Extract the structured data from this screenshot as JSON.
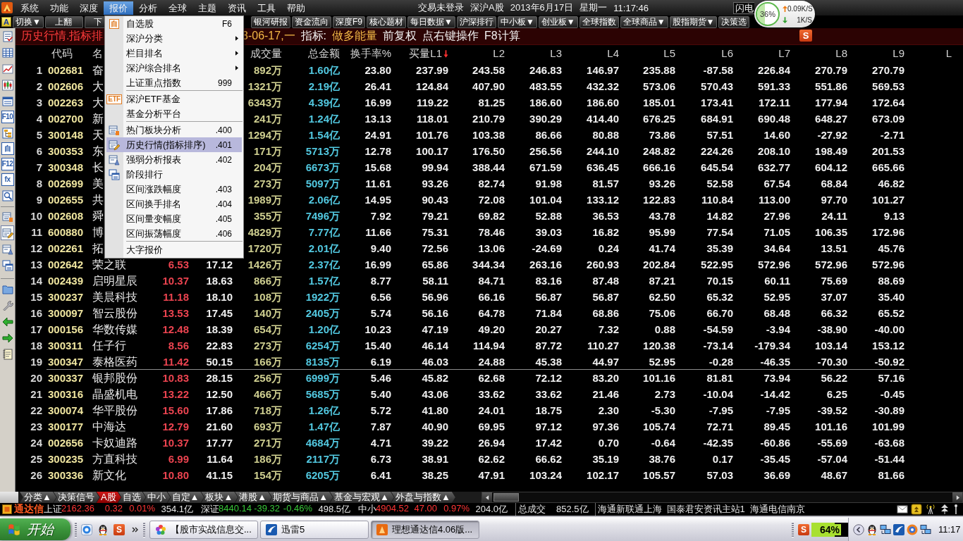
{
  "menubar": {
    "items": [
      {
        "label": "系统",
        "selected": false
      },
      {
        "label": "功能",
        "selected": false
      },
      {
        "label": "深度",
        "selected": false
      },
      {
        "label": "报价",
        "selected": true
      },
      {
        "label": "分析",
        "selected": false
      },
      {
        "label": "全球",
        "selected": false
      },
      {
        "label": "主题",
        "selected": false
      },
      {
        "label": "资讯",
        "selected": false
      },
      {
        "label": "工具",
        "selected": false
      },
      {
        "label": "帮助",
        "selected": false
      }
    ],
    "login_status": "交易未登录",
    "market": "深沪A股",
    "date": "2013年6月17日",
    "weekday": "星期一",
    "time": "11:17:46",
    "flash_box": "闪电"
  },
  "speed_widget": {
    "level": 0.36,
    "reading": "36%",
    "upload": "0.09K/S",
    "download": "1K/S"
  },
  "ime_toolbar": {
    "badge": "S"
  },
  "toolbar": {
    "tile": "A",
    "left": [
      "切换▼",
      "上翻",
      "下"
    ],
    "right": [
      "银河研报",
      "资金流向",
      "深度F9",
      "核心题材",
      "每日数据▼",
      "沪深排行",
      "中小板▼",
      "创业板▼",
      "全球指数",
      "全球商品▼",
      "股指期货▼",
      "决策选"
    ]
  },
  "sidebar": {
    "groups": [
      {
        "tools": [
          {
            "kind": "report",
            "selected": false
          },
          {
            "kind": "grid",
            "selected": false
          },
          {
            "kind": "line",
            "selected": false
          },
          {
            "kind": "candle",
            "selected": false
          },
          {
            "kind": "window",
            "selected": false
          },
          {
            "kind": "glyph",
            "glyph": "F10",
            "selected": false
          },
          {
            "kind": "tree",
            "selected": false
          },
          {
            "kind": "glyph",
            "glyph": "自",
            "selected": false
          },
          {
            "kind": "glyph",
            "glyph": "F12",
            "selected": false
          },
          {
            "kind": "glyph",
            "glyph": "fx",
            "selected": false
          },
          {
            "kind": "search",
            "selected": false
          }
        ]
      },
      {
        "tools": [
          {
            "kind": "hot",
            "selected": false
          },
          {
            "kind": "pencil",
            "selected": true
          },
          {
            "kind": "sheet",
            "selected": false
          },
          {
            "kind": "stack",
            "selected": false
          }
        ]
      },
      {
        "tools": [
          {
            "kind": "folder",
            "selected": false
          },
          {
            "kind": "wrench",
            "selected": false
          },
          {
            "kind": "back",
            "selected": false
          },
          {
            "kind": "forward",
            "selected": false
          },
          {
            "kind": "notebook",
            "selected": false
          }
        ]
      }
    ]
  },
  "title_bar": {
    "title": "历史行情.指标排",
    "info": [
      {
        "text": "3-06-17,一",
        "kind": "highlight"
      },
      {
        "text": "指标:",
        "kind": "plain"
      },
      {
        "text": "做多能量",
        "kind": "highlight"
      },
      {
        "text": "前复权",
        "kind": "plain"
      },
      {
        "text": "点右键操作",
        "kind": "plain"
      },
      {
        "text": "F8计算",
        "kind": "plain"
      }
    ]
  },
  "table": {
    "header": {
      "code": "代码",
      "name": "名",
      "volume": "成交量",
      "amount": "总金额",
      "turnover": "换手率%",
      "l_columns": [
        {
          "label": "买量L1",
          "sorted": true
        },
        {
          "label": "L2",
          "sorted": false
        },
        {
          "label": "L3",
          "sorted": false
        },
        {
          "label": "L4",
          "sorted": false
        },
        {
          "label": "L5",
          "sorted": false
        },
        {
          "label": "L6",
          "sorted": false
        },
        {
          "label": "L7",
          "sorted": false
        },
        {
          "label": "L8",
          "sorted": false
        },
        {
          "label": "L9",
          "sorted": false
        },
        {
          "label": "L",
          "sorted": false
        }
      ]
    },
    "rows": [
      {
        "no": "1",
        "code": "002681",
        "name": "奋",
        "volume": "892万",
        "amount": "1.60亿",
        "turnover": "23.80",
        "l_values": [
          "237.99",
          "243.58",
          "246.83",
          "146.97",
          "235.88",
          "-87.58",
          "226.84",
          "270.79",
          "270.79"
        ],
        "rule_below": false
      },
      {
        "no": "2",
        "code": "002606",
        "name": "大",
        "volume": "1321万",
        "amount": "2.19亿",
        "turnover": "26.41",
        "l_values": [
          "124.84",
          "407.90",
          "483.55",
          "432.32",
          "573.06",
          "570.43",
          "591.33",
          "551.86",
          "569.53"
        ],
        "rule_below": false
      },
      {
        "no": "3",
        "code": "002263",
        "name": "大",
        "volume": "6343万",
        "amount": "4.39亿",
        "turnover": "16.99",
        "l_values": [
          "119.22",
          "81.25",
          "186.60",
          "186.60",
          "185.01",
          "173.41",
          "172.11",
          "177.94",
          "172.64"
        ],
        "rule_below": false
      },
      {
        "no": "4",
        "code": "002700",
        "name": "新",
        "volume": "241万",
        "amount": "1.24亿",
        "turnover": "13.13",
        "l_values": [
          "118.01",
          "210.79",
          "390.29",
          "414.40",
          "676.25",
          "684.91",
          "690.48",
          "648.27",
          "673.09"
        ],
        "rule_below": false
      },
      {
        "no": "5",
        "code": "300148",
        "name": "天",
        "volume": "1294万",
        "amount": "1.54亿",
        "turnover": "24.91",
        "l_values": [
          "101.76",
          "103.38",
          "86.66",
          "80.88",
          "73.86",
          "57.51",
          "14.60",
          "-27.92",
          "-2.71"
        ],
        "rule_below": false
      },
      {
        "no": "6",
        "code": "300353",
        "name": "东",
        "volume": "171万",
        "amount": "5713万",
        "turnover": "12.78",
        "l_values": [
          "100.17",
          "176.50",
          "256.56",
          "244.10",
          "248.82",
          "224.26",
          "208.10",
          "198.49",
          "201.53"
        ],
        "rule_below": false
      },
      {
        "no": "7",
        "code": "300348",
        "name": "长",
        "volume": "204万",
        "amount": "6673万",
        "turnover": "15.68",
        "l_values": [
          "99.94",
          "388.44",
          "671.59",
          "636.45",
          "666.16",
          "645.54",
          "632.77",
          "604.12",
          "665.66"
        ],
        "rule_below": false
      },
      {
        "no": "8",
        "code": "002699",
        "name": "美",
        "volume": "273万",
        "amount": "5097万",
        "turnover": "11.61",
        "l_values": [
          "93.26",
          "82.74",
          "91.98",
          "81.57",
          "93.26",
          "52.58",
          "67.54",
          "68.84",
          "46.82"
        ],
        "rule_below": false
      },
      {
        "no": "9",
        "code": "002655",
        "name": "共",
        "volume": "1989万",
        "amount": "2.06亿",
        "turnover": "14.95",
        "l_values": [
          "90.43",
          "72.08",
          "101.04",
          "133.12",
          "122.83",
          "110.84",
          "113.00",
          "97.70",
          "101.27"
        ],
        "rule_below": false
      },
      {
        "no": "10",
        "code": "002608",
        "name": "舜",
        "volume": "355万",
        "amount": "7496万",
        "turnover": "7.92",
        "l_values": [
          "79.21",
          "69.82",
          "52.88",
          "36.53",
          "43.78",
          "14.82",
          "27.96",
          "24.11",
          "9.13"
        ],
        "rule_below": false
      },
      {
        "no": "11",
        "code": "600880",
        "name": "博",
        "volume": "4829万",
        "amount": "7.77亿",
        "turnover": "11.66",
        "l_values": [
          "75.31",
          "78.46",
          "39.03",
          "16.82",
          "95.99",
          "77.54",
          "71.05",
          "106.35",
          "172.96"
        ],
        "rule_below": false
      },
      {
        "no": "12",
        "code": "002261",
        "name": "拓",
        "volume": "1720万",
        "amount": "2.01亿",
        "turnover": "9.40",
        "l_values": [
          "72.56",
          "13.06",
          "-24.69",
          "0.24",
          "41.74",
          "35.39",
          "34.64",
          "13.51",
          "45.76"
        ],
        "rule_below": false
      },
      {
        "no": "13",
        "code": "002642",
        "name": "荣之联",
        "column_3": "6.53",
        "column_4": "17.12",
        "volume": "1426万",
        "amount": "2.37亿",
        "turnover": "16.99",
        "l_values": [
          "65.86",
          "344.34",
          "263.16",
          "260.93",
          "202.84",
          "522.95",
          "572.96",
          "572.96",
          "572.96"
        ],
        "rule_below": false
      },
      {
        "no": "14",
        "code": "002439",
        "name": "启明星辰",
        "column_3": "10.37",
        "column_4": "18.63",
        "volume": "866万",
        "amount": "1.57亿",
        "turnover": "8.77",
        "l_values": [
          "58.11",
          "84.71",
          "83.16",
          "87.48",
          "87.21",
          "70.15",
          "60.11",
          "75.69",
          "88.69"
        ],
        "rule_below": false
      },
      {
        "no": "15",
        "code": "300237",
        "name": "美晨科技",
        "column_3": "11.18",
        "column_4": "18.10",
        "volume": "108万",
        "amount": "1922万",
        "turnover": "6.56",
        "l_values": [
          "56.96",
          "66.16",
          "56.87",
          "56.87",
          "62.50",
          "65.32",
          "52.95",
          "37.07",
          "35.40"
        ],
        "rule_below": false
      },
      {
        "no": "16",
        "code": "300097",
        "name": "智云股份",
        "column_3": "13.53",
        "column_4": "17.45",
        "volume": "140万",
        "amount": "2405万",
        "turnover": "5.74",
        "l_values": [
          "56.16",
          "64.78",
          "71.84",
          "68.86",
          "75.06",
          "66.70",
          "68.48",
          "66.32",
          "65.52"
        ],
        "rule_below": false
      },
      {
        "no": "17",
        "code": "000156",
        "name": "华数传媒",
        "column_3": "12.48",
        "column_4": "18.39",
        "volume": "654万",
        "amount": "1.20亿",
        "turnover": "10.23",
        "l_values": [
          "47.19",
          "49.20",
          "20.27",
          "7.32",
          "0.88",
          "-54.59",
          "-3.94",
          "-38.90",
          "-40.00"
        ],
        "rule_below": false
      },
      {
        "no": "18",
        "code": "300311",
        "name": "任子行",
        "column_3": "8.56",
        "column_4": "22.83",
        "volume": "273万",
        "amount": "6254万",
        "turnover": "15.40",
        "l_values": [
          "46.14",
          "114.94",
          "87.72",
          "110.27",
          "120.38",
          "-73.14",
          "-179.34",
          "103.14",
          "153.12"
        ],
        "rule_below": false
      },
      {
        "no": "19",
        "code": "300347",
        "name": "泰格医药",
        "column_3": "11.42",
        "column_4": "50.15",
        "volume": "166万",
        "amount": "8135万",
        "turnover": "6.19",
        "l_values": [
          "46.03",
          "24.88",
          "45.38",
          "44.97",
          "52.95",
          "-0.28",
          "-46.35",
          "-70.30",
          "-50.92"
        ],
        "rule_below": true
      },
      {
        "no": "20",
        "code": "300337",
        "name": "银邦股份",
        "column_3": "10.83",
        "column_4": "28.15",
        "volume": "256万",
        "amount": "6999万",
        "turnover": "5.46",
        "l_values": [
          "45.82",
          "62.68",
          "72.12",
          "83.20",
          "101.16",
          "81.81",
          "73.94",
          "56.22",
          "57.16"
        ],
        "rule_below": false
      },
      {
        "no": "21",
        "code": "300316",
        "name": "晶盛机电",
        "column_3": "13.22",
        "column_4": "12.50",
        "volume": "466万",
        "amount": "5685万",
        "turnover": "5.40",
        "l_values": [
          "43.06",
          "33.62",
          "33.62",
          "21.46",
          "2.73",
          "-10.04",
          "-14.42",
          "6.25",
          "-0.45"
        ],
        "rule_below": false
      },
      {
        "no": "22",
        "code": "300074",
        "name": "华平股份",
        "column_3": "15.60",
        "column_4": "17.86",
        "volume": "718万",
        "amount": "1.26亿",
        "turnover": "5.72",
        "l_values": [
          "41.80",
          "24.01",
          "18.75",
          "2.30",
          "-5.30",
          "-7.95",
          "-7.95",
          "-39.52",
          "-30.89"
        ],
        "rule_below": false
      },
      {
        "no": "23",
        "code": "300177",
        "name": "中海达",
        "column_3": "12.79",
        "column_4": "21.60",
        "volume": "693万",
        "amount": "1.47亿",
        "turnover": "7.87",
        "l_values": [
          "40.90",
          "69.95",
          "97.12",
          "97.36",
          "105.74",
          "72.71",
          "89.45",
          "101.16",
          "101.99"
        ],
        "rule_below": false
      },
      {
        "no": "24",
        "code": "002656",
        "name": "卡奴迪路",
        "column_3": "10.37",
        "column_4": "17.77",
        "volume": "271万",
        "amount": "4684万",
        "turnover": "4.71",
        "l_values": [
          "39.22",
          "26.94",
          "17.42",
          "0.70",
          "-0.64",
          "-42.35",
          "-60.86",
          "-55.69",
          "-63.68"
        ],
        "rule_below": false
      },
      {
        "no": "25",
        "code": "300235",
        "name": "方直科技",
        "column_3": "6.99",
        "column_4": "11.64",
        "volume": "186万",
        "amount": "2117万",
        "turnover": "6.73",
        "l_values": [
          "38.91",
          "62.62",
          "66.62",
          "35.19",
          "38.76",
          "0.17",
          "-35.45",
          "-57.04",
          "-51.44"
        ],
        "rule_below": false
      },
      {
        "no": "26",
        "code": "300336",
        "name": "新文化",
        "column_3": "10.80",
        "column_4": "41.15",
        "volume": "154万",
        "amount": "6205万",
        "turnover": "6.41",
        "l_values": [
          "38.25",
          "47.91",
          "103.24",
          "102.17",
          "105.57",
          "57.03",
          "36.69",
          "48.67",
          "81.66"
        ],
        "rule_below": false
      }
    ]
  },
  "dropdown": {
    "groups": [
      {
        "items": [
          {
            "label": "自选股",
            "kind": "badge",
            "badge": "自",
            "shortcut": "F6",
            "submenu": false,
            "selected": false
          },
          {
            "label": "深沪分类",
            "kind": "plain",
            "submenu": true,
            "selected": false
          },
          {
            "label": "栏目排名",
            "kind": "plain",
            "submenu": true,
            "selected": false
          },
          {
            "label": "深沪综合排名",
            "kind": "plain",
            "submenu": true,
            "selected": false
          },
          {
            "label": "上证重点指数",
            "kind": "plain",
            "shortcut": "999",
            "submenu": false,
            "selected": false
          }
        ]
      },
      {
        "items": [
          {
            "label": "深沪ETF基金",
            "kind": "badge",
            "badge": "ETF",
            "submenu": false,
            "selected": false
          },
          {
            "label": "基金分析平台",
            "kind": "plain",
            "submenu": false,
            "selected": false
          }
        ]
      },
      {
        "items": [
          {
            "label": "热门板块分析",
            "kind": "hot",
            "shortcut": ".400",
            "submenu": false,
            "selected": false
          },
          {
            "label": "历史行情(指标排序)",
            "kind": "pencil",
            "shortcut": ".401",
            "submenu": false,
            "selected": true
          },
          {
            "label": "强弱分析报表",
            "kind": "sheet",
            "shortcut": ".402",
            "submenu": false,
            "selected": false
          },
          {
            "label": "阶段排行",
            "kind": "stack",
            "submenu": false,
            "selected": false
          },
          {
            "label": "区间涨跌幅度",
            "kind": "plain",
            "shortcut": ".403",
            "submenu": false,
            "selected": false
          },
          {
            "label": "区间换手排名",
            "kind": "plain",
            "shortcut": ".404",
            "submenu": false,
            "selected": false
          },
          {
            "label": "区间量变幅度",
            "kind": "plain",
            "shortcut": ".405",
            "submenu": false,
            "selected": false
          },
          {
            "label": "区间振荡幅度",
            "kind": "plain",
            "shortcut": ".406",
            "submenu": false,
            "selected": false
          }
        ]
      },
      {
        "items": [
          {
            "label": "大字报价",
            "kind": "plain",
            "submenu": false,
            "selected": false
          }
        ]
      }
    ]
  },
  "bottom_tabs": {
    "tabs": [
      {
        "label": "分类▲",
        "selected": false
      },
      {
        "label": "决策信号",
        "selected": false
      },
      {
        "label": "A股",
        "selected": true
      },
      {
        "label": "自选",
        "selected": false
      },
      {
        "label": "中小",
        "selected": false
      },
      {
        "label": "自定▲",
        "selected": false
      },
      {
        "label": "板块▲",
        "selected": false
      },
      {
        "label": "港股▲",
        "selected": false
      },
      {
        "label": "期货与商品▲",
        "selected": false
      },
      {
        "label": "基金与宏观▲",
        "selected": false
      },
      {
        "label": "外盘与指数▲",
        "selected": false
      }
    ]
  },
  "status_bar": {
    "brand": "通达信",
    "indices": [
      {
        "name": "上证",
        "rising": true,
        "values": [
          "2162.36",
          "0.32",
          "0.01%"
        ],
        "amount": "354.1亿"
      },
      {
        "name": "深证",
        "rising": false,
        "values": [
          "8440.14",
          "-39.32",
          "-0.46%"
        ],
        "amount": "498.5亿"
      },
      {
        "name": "中小",
        "rising": true,
        "values": [
          "4904.52",
          "47.00",
          "0.97%"
        ],
        "amount": "204.0亿"
      }
    ],
    "total_label": "总成交",
    "total": "852.5亿",
    "servers": [
      "海通新联通上海",
      "国泰君安资讯主站1",
      "海通电信南京"
    ]
  },
  "taskbar": {
    "start": "开始",
    "quick_launch_badge": "S",
    "windows": [
      {
        "title": "【股市实战信息交...",
        "kind": "browser",
        "selected": false
      },
      {
        "title": "迅雷5",
        "kind": "downloader",
        "selected": false
      },
      {
        "title": "理想通达信4.06版...",
        "kind": "trading",
        "selected": true
      }
    ],
    "tray_badge": "S",
    "meter": {
      "level": 0.64,
      "reading": "64%"
    },
    "clock": "11:17"
  }
}
